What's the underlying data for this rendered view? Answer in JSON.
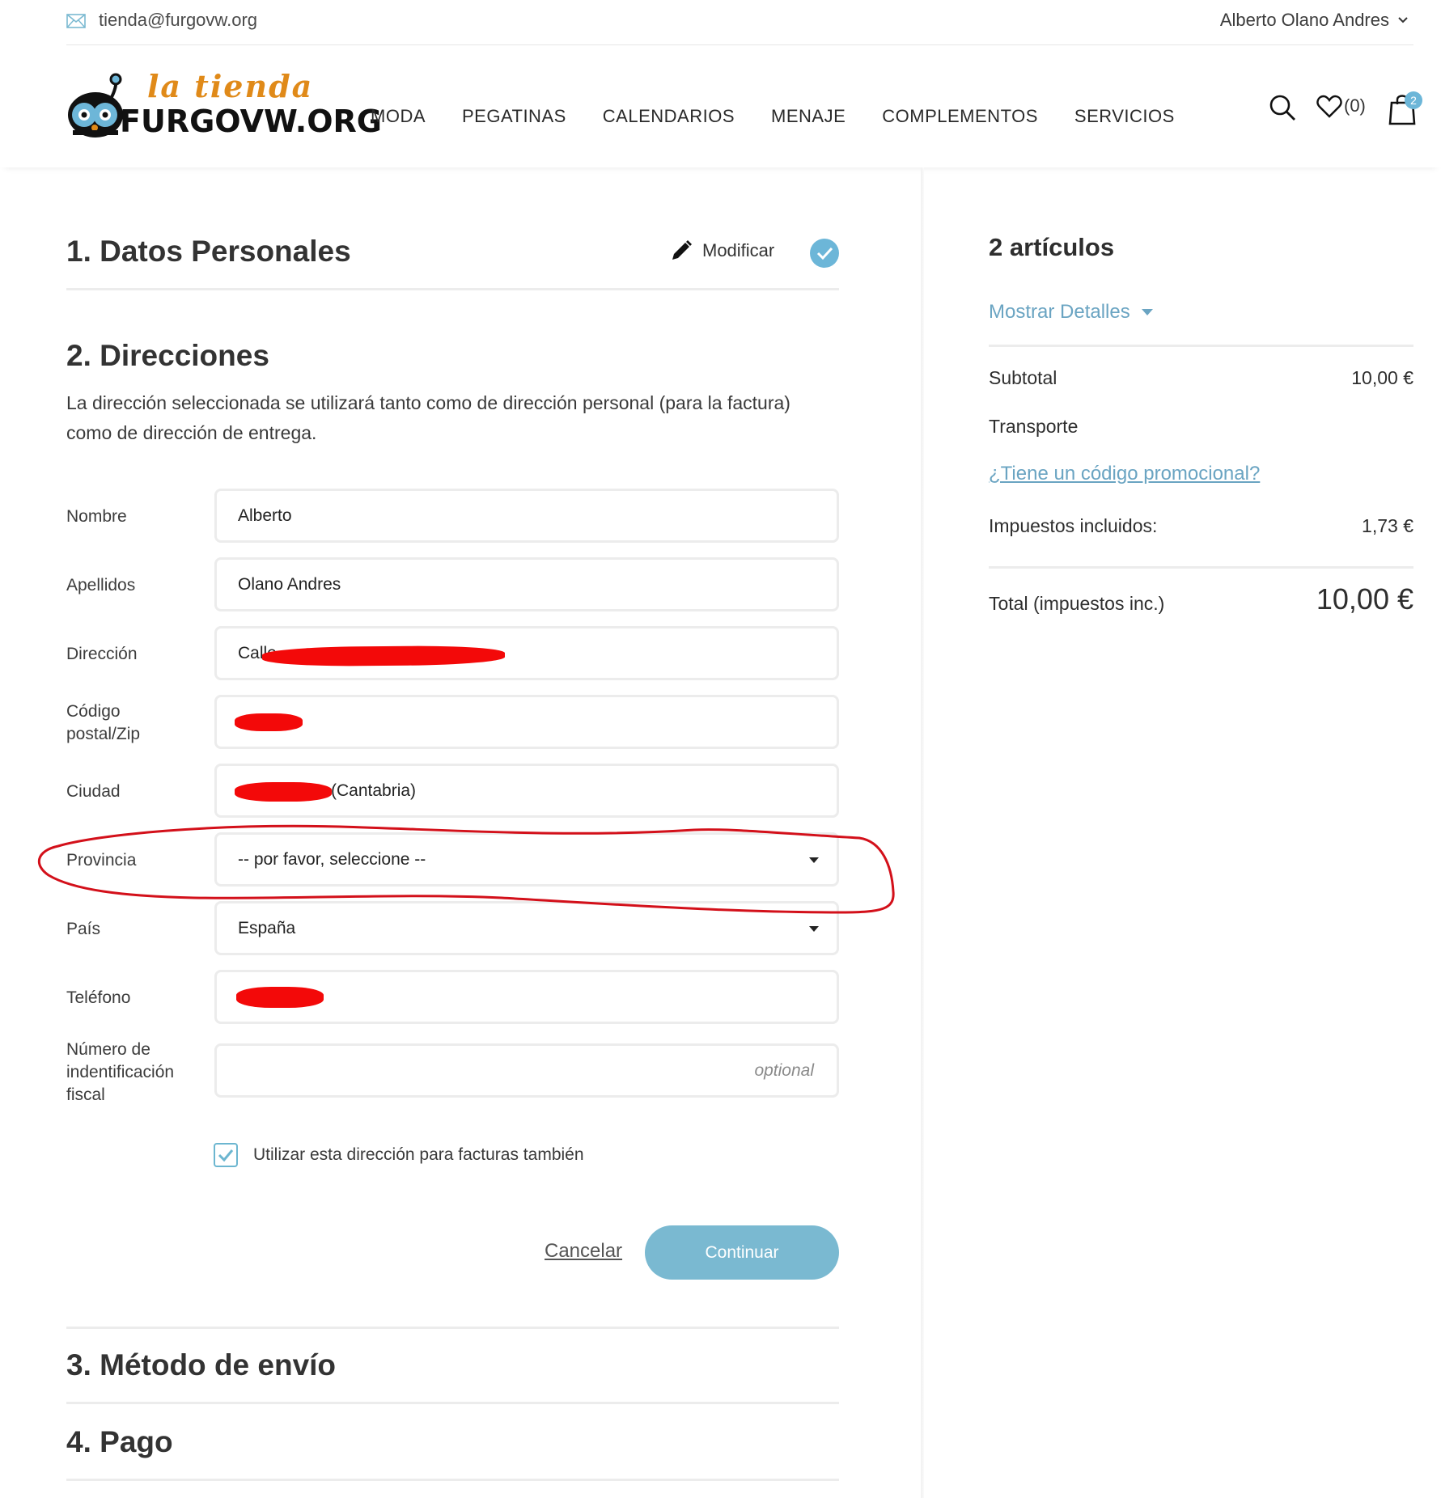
{
  "topbar": {
    "email": "tienda@furgovw.org",
    "user": "Alberto Olano Andres",
    "icons": [
      "mail-icon",
      "chevron-down-icon"
    ]
  },
  "header": {
    "logo": {
      "script": "la tienda",
      "main": "FURGOVW.ORG"
    },
    "nav": [
      "MODA",
      "PEGATINAS",
      "CALENDARIOS",
      "MENAJE",
      "COMPLEMENTOS",
      "SERVICIOS"
    ],
    "wishlist_count": "(0)",
    "cart_count": "2",
    "icons": [
      "search-icon",
      "heart-icon",
      "shopping-bag-icon"
    ]
  },
  "steps": {
    "step1": {
      "title": "1. Datos Personales",
      "edit_label": "Modificar",
      "icons": [
        "pencil-icon",
        "check-circle-icon"
      ]
    },
    "step2": {
      "title": "2. Direcciones",
      "description": "La dirección seleccionada se utilizará tanto como de dirección personal (para la factura) como de dirección de entrega."
    },
    "step3": {
      "title": "3. Método de envío"
    },
    "step4": {
      "title": "4. Pago"
    }
  },
  "form": {
    "nombre": {
      "label": "Nombre",
      "value": "Alberto"
    },
    "apellidos": {
      "label": "Apellidos",
      "value": "Olano Andres"
    },
    "direccion": {
      "label": "Dirección",
      "value": "Calle"
    },
    "codigo_postal": {
      "label_line1": "Código",
      "label_line2": "postal/Zip",
      "value": ""
    },
    "ciudad": {
      "label": "Ciudad",
      "value": "(Cantabria)"
    },
    "provincia": {
      "label": "Provincia",
      "selected": "-- por favor, seleccione --"
    },
    "pais": {
      "label": "País",
      "selected": "España"
    },
    "telefono": {
      "label": "Teléfono",
      "value": ""
    },
    "nif": {
      "label_line1": "Número de",
      "label_line2": "indentificación",
      "label_line3": "fiscal",
      "placeholder": "optional"
    },
    "use_for_invoice": {
      "label": "Utilizar esta dirección para facturas también",
      "checked": true
    },
    "cancel_label": "Cancelar",
    "continue_label": "Continuar"
  },
  "summary": {
    "title": "2 artículos",
    "show_details": "Mostrar Detalles",
    "subtotal_label": "Subtotal",
    "subtotal_value": "10,00 €",
    "shipping_label": "Transporte",
    "promo_link": "¿Tiene un código promocional?",
    "taxes_label": "Impuestos incluidos:",
    "taxes_value": "1,73 €",
    "total_label": "Total (impuestos inc.)",
    "total_value": "10,00 €"
  },
  "colors": {
    "accent": "#7ab9d1",
    "link": "#6aa4c2",
    "logo_orange": "#e08a19",
    "annotation_red": "#d3101a"
  }
}
